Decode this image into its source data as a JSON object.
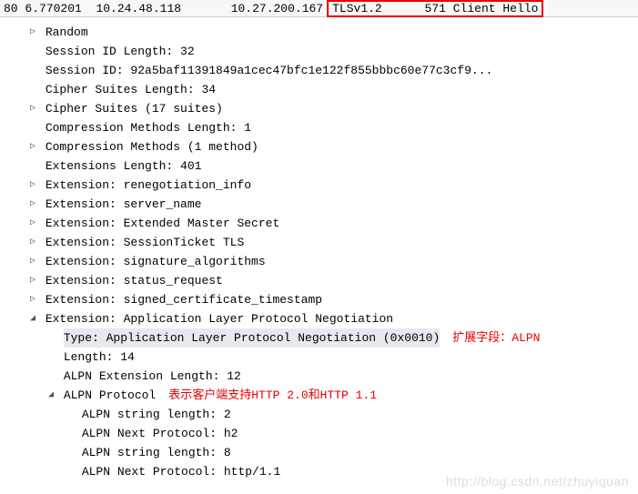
{
  "packet": {
    "no": "80",
    "time": "6.770201",
    "src": "10.24.48.118",
    "dst": "10.27.200.167",
    "proto": "TLSv1.2",
    "len": "571",
    "info": "Client Hello"
  },
  "tree": [
    {
      "indent": 1,
      "toggle": "▷",
      "text": "Random"
    },
    {
      "indent": 1,
      "toggle": "",
      "text": "Session ID Length: 32"
    },
    {
      "indent": 1,
      "toggle": "",
      "text": "Session ID: 92a5baf11391849a1cec47bfc1e122f855bbbc60e77c3cf9..."
    },
    {
      "indent": 1,
      "toggle": "",
      "text": "Cipher Suites Length: 34"
    },
    {
      "indent": 1,
      "toggle": "▷",
      "text": "Cipher Suites (17 suites)"
    },
    {
      "indent": 1,
      "toggle": "",
      "text": "Compression Methods Length: 1"
    },
    {
      "indent": 1,
      "toggle": "▷",
      "text": "Compression Methods (1 method)"
    },
    {
      "indent": 1,
      "toggle": "",
      "text": "Extensions Length: 401"
    },
    {
      "indent": 1,
      "toggle": "▷",
      "text": "Extension: renegotiation_info"
    },
    {
      "indent": 1,
      "toggle": "▷",
      "text": "Extension: server_name"
    },
    {
      "indent": 1,
      "toggle": "▷",
      "text": "Extension: Extended Master Secret"
    },
    {
      "indent": 1,
      "toggle": "▷",
      "text": "Extension: SessionTicket TLS"
    },
    {
      "indent": 1,
      "toggle": "▷",
      "text": "Extension: signature_algorithms"
    },
    {
      "indent": 1,
      "toggle": "▷",
      "text": "Extension: status_request"
    },
    {
      "indent": 1,
      "toggle": "▷",
      "text": "Extension: signed_certificate_timestamp"
    },
    {
      "indent": 1,
      "toggle": "◢",
      "text": "Extension: Application Layer Protocol Negotiation"
    },
    {
      "indent": 2,
      "toggle": "",
      "text": "Type: Application Layer Protocol Negotiation (0x0010)",
      "highlight": true,
      "annotation": "扩展字段：ALPN"
    },
    {
      "indent": 2,
      "toggle": "",
      "text": "Length: 14"
    },
    {
      "indent": 2,
      "toggle": "",
      "text": "ALPN Extension Length: 12"
    },
    {
      "indent": 2,
      "toggle": "◢",
      "text": "ALPN Protocol",
      "annotation": "表示客户端支持HTTP 2.0和HTTP 1.1"
    },
    {
      "indent": 3,
      "toggle": "",
      "text": "ALPN string length: 2"
    },
    {
      "indent": 3,
      "toggle": "",
      "text": "ALPN Next Protocol: h2"
    },
    {
      "indent": 3,
      "toggle": "",
      "text": "ALPN string length: 8"
    },
    {
      "indent": 3,
      "toggle": "",
      "text": "ALPN Next Protocol: http/1.1"
    }
  ],
  "watermark": "http://blog.csdn.net/zhuyiquan"
}
